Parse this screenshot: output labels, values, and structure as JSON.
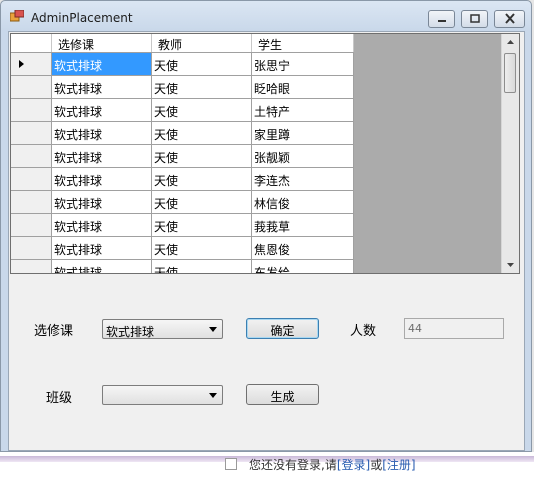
{
  "window": {
    "title": "AdminPlacement"
  },
  "grid": {
    "columns": [
      "选修课",
      "教师",
      "学生"
    ],
    "rows": [
      [
        "软式排球",
        "天使",
        "张思宁"
      ],
      [
        "软式排球",
        "天使",
        "眨哈眼"
      ],
      [
        "软式排球",
        "天使",
        "土特产"
      ],
      [
        "软式排球",
        "天使",
        "家里蹲"
      ],
      [
        "软式排球",
        "天使",
        "张靓颖"
      ],
      [
        "软式排球",
        "天使",
        "李连杰"
      ],
      [
        "软式排球",
        "天使",
        "林信俊"
      ],
      [
        "软式排球",
        "天使",
        "莪莪草"
      ],
      [
        "软式排球",
        "天使",
        "焦恩俊"
      ],
      [
        "软式排球",
        "天使",
        "东发给"
      ]
    ]
  },
  "form": {
    "course_label": "选修课",
    "course_value": "软式排球",
    "confirm_button": "确定",
    "count_label": "人数",
    "count_value": "44",
    "class_label": "班级",
    "class_value": "",
    "generate_button": "生成"
  },
  "background": {
    "text_prefix": "您还没有登录,请",
    "login_link": "[登录]",
    "or_text": "或",
    "register_link": "[注册]"
  }
}
